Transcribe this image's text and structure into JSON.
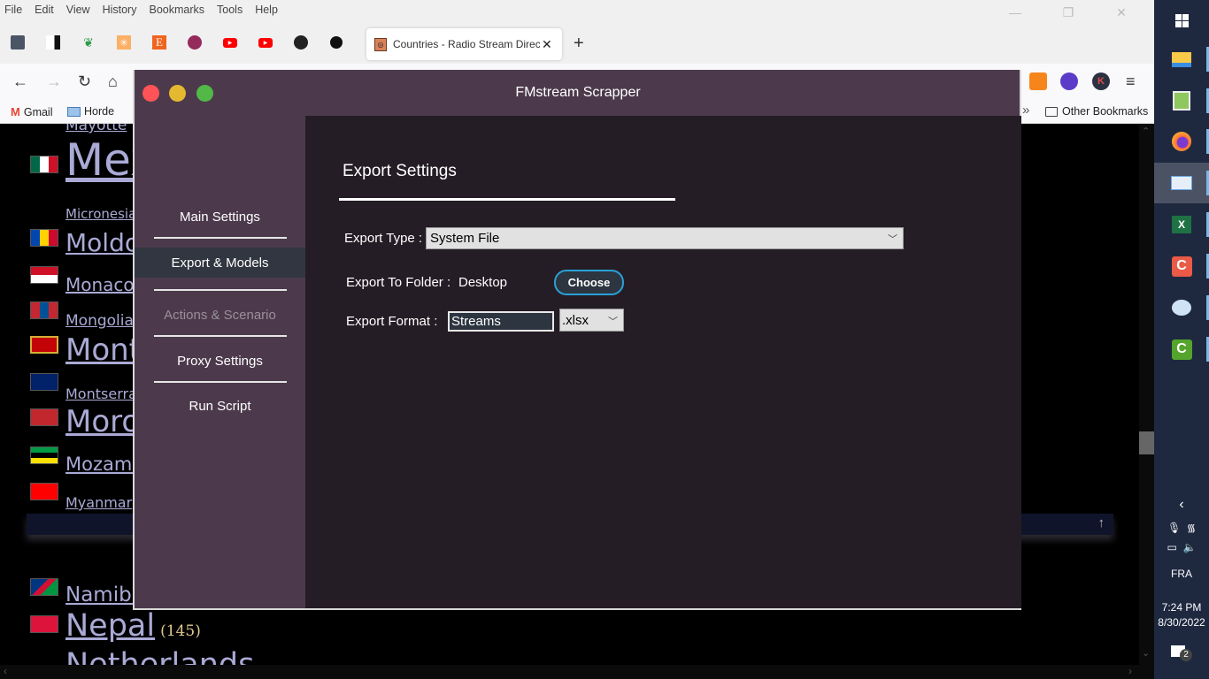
{
  "browser": {
    "menu": [
      "File",
      "Edit",
      "View",
      "History",
      "Bookmarks",
      "Tools",
      "Help"
    ],
    "window_controls": {
      "minimize": "—",
      "restore": "❐",
      "close": "✕"
    },
    "pinned_tabs": [
      "save-icon",
      "bird-icon",
      "leaf-icon",
      "network-icon",
      "etsy-icon",
      "circle-icon",
      "youtube-icon",
      "youtube-icon",
      "github-icon",
      "headset-icon"
    ],
    "active_tab": {
      "title": "Countries - Radio Stream Directory",
      "close": "✕"
    },
    "new_tab": "+",
    "nav": {
      "back": "←",
      "forward": "→",
      "reload": "↻",
      "home": "⌂",
      "menu": "≡"
    },
    "extensions": {
      "k_label": "K"
    },
    "bookmarks": [
      {
        "label": "Gmail",
        "icon": "gmail-icon"
      },
      {
        "label": "Horde",
        "icon": "mail-icon"
      }
    ],
    "bookmarks_overflow": "»",
    "other_bookmarks": "Other Bookmarks"
  },
  "page": {
    "countries": [
      {
        "name": "Mayotte"
      },
      {
        "name": "Mexico"
      },
      {
        "name": "Micronesia"
      },
      {
        "name": "Moldova"
      },
      {
        "name": "Monaco"
      },
      {
        "name": "Mongolia"
      },
      {
        "name": "Montenegro"
      },
      {
        "name": "Montserrat"
      },
      {
        "name": "Morocco"
      },
      {
        "name": "Mozambique"
      },
      {
        "name": "Myanmar"
      },
      {
        "name": "Namibia"
      },
      {
        "name": "Nepal",
        "count": "(145)"
      },
      {
        "name": "Netherlands"
      }
    ],
    "back_to_top": "↑"
  },
  "app": {
    "title": "FMstream Scrapper",
    "sidebar": [
      {
        "label": "Main Settings",
        "state": "normal"
      },
      {
        "label": "Export & Models",
        "state": "active"
      },
      {
        "label": "Actions & Scenario",
        "state": "disabled"
      },
      {
        "label": "Proxy Settings",
        "state": "normal"
      },
      {
        "label": "Run Script",
        "state": "normal"
      }
    ],
    "export": {
      "section_title": "Export Settings",
      "type_label": "Export Type :",
      "type_value": "System File",
      "folder_label": "Export To Folder :",
      "folder_value": "Desktop",
      "choose_label": "Choose",
      "format_label": "Export Format :",
      "file_name_value": "Streams",
      "format_value": ".xlsx"
    },
    "colors": {
      "close": "#fe5457",
      "minimize": "#e4b92f",
      "maximize": "#52b847",
      "accent": "#2aa0d8"
    }
  },
  "taskbar": {
    "apps": [
      "windows-start-icon",
      "file-explorer-icon",
      "notepad-plus-icon",
      "firefox-icon",
      "remote-desktop-icon",
      "excel-icon",
      "camtasia-icon",
      "paint-icon",
      "camtasia-green-icon"
    ],
    "language": "FRA",
    "time": "7:24 PM",
    "date": "8/30/2022",
    "notifications": "2",
    "chevron": "‹"
  }
}
